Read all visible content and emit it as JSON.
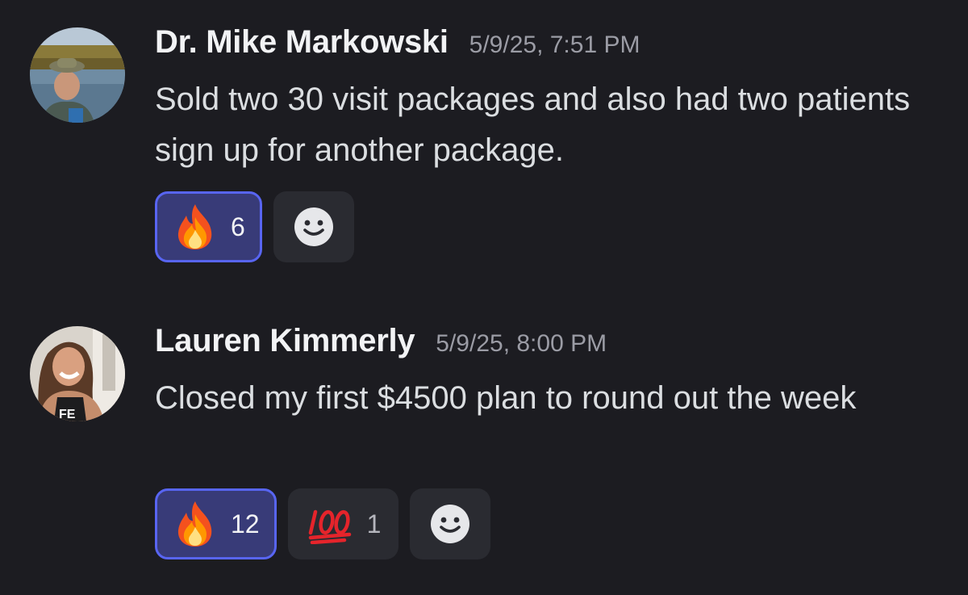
{
  "messages": [
    {
      "author": "Dr. Mike Markowski",
      "timestamp": "5/9/25, 7:51 PM",
      "content": "Sold two 30 visit packages and also had two patients sign up for another package.",
      "reactions": [
        {
          "emoji": "fire-icon",
          "count": "6",
          "active": true
        }
      ],
      "add_reaction_icon": "smiley-add-reaction-icon"
    },
    {
      "author": "Lauren Kimmerly",
      "timestamp": "5/9/25, 8:00 PM",
      "content": "Closed my first $4500 plan to round out the week",
      "reactions": [
        {
          "emoji": "fire-icon",
          "count": "12",
          "active": true
        },
        {
          "emoji": "hundred-points-icon",
          "count": "1",
          "active": false
        }
      ],
      "add_reaction_icon": "smiley-add-reaction-icon"
    }
  ],
  "colors": {
    "background": "#1c1c21",
    "active_reaction_bg": "#383b78",
    "active_reaction_border": "#5865f2",
    "reaction_bg": "#2a2b31",
    "author_text": "#f2f3f5",
    "timestamp_text": "#9b9ca5",
    "body_text": "#dbdee1"
  }
}
